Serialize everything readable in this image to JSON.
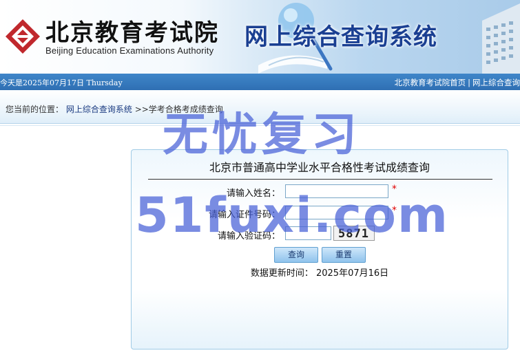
{
  "header": {
    "logo_cn": "北京教育考试院",
    "logo_en": "Beijing Education Examinations Authority",
    "system_title": "网上综合查询系统"
  },
  "topbar": {
    "date_text": "今天是2025年07月17日 Thursday",
    "links": [
      "北京教育考试院首页",
      "网上综合查询"
    ],
    "separator": "|"
  },
  "breadcrumb": {
    "prefix": "您当前的位置：",
    "items": [
      "网上综合查询系统",
      ">>学考合格考成绩查询"
    ]
  },
  "form": {
    "title": "北京市普通高中学业水平合格性考试成绩查询",
    "name_label": "请输入姓名：",
    "name_value": "",
    "id_label": "请输入证件号码：",
    "id_value": "",
    "captcha_label": "请输入验证码：",
    "captcha_value": "",
    "captcha_text": "5871",
    "required_mark": "*",
    "query_button": "查询",
    "reset_button": "重置",
    "update_label": "数据更新时间：",
    "update_date": "2025年07月16日"
  },
  "watermark": {
    "line1": "无忧复习",
    "line2": "51fuxi.com"
  },
  "colors": {
    "topbar": "#2f6fb3",
    "title_blue": "#1a3f92",
    "logo_red": "#c0282d",
    "required": "#e00000",
    "watermark": "#465fd7"
  }
}
